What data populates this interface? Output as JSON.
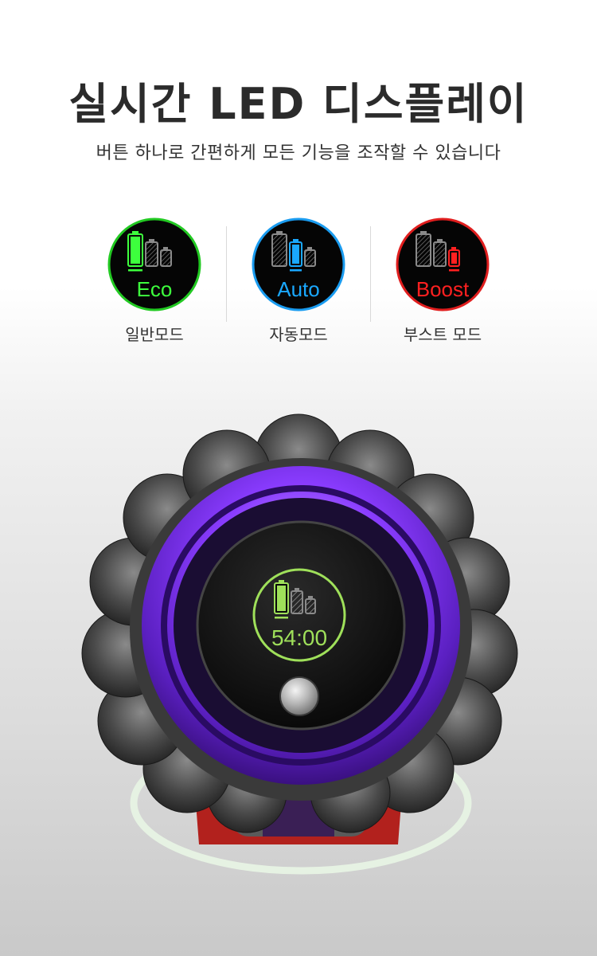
{
  "header": {
    "title": "실시간 LED 디스플레이",
    "subtitle": "버튼 하나로 간편하게 모든 기능을 조작할 수 있습니다"
  },
  "modes": [
    {
      "badge": "Eco",
      "label": "일반모드",
      "accent": "#3dff3d",
      "ring": "#22c922",
      "icon": "battery-high-icon"
    },
    {
      "badge": "Auto",
      "label": "자동모드",
      "accent": "#1aa8ff",
      "ring": "#1a9cf0",
      "icon": "battery-medium-icon"
    },
    {
      "badge": "Boost",
      "label": "부스트 모드",
      "accent": "#ff2020",
      "ring": "#e01e1e",
      "icon": "battery-low-icon"
    }
  ],
  "display": {
    "time": "54:00",
    "accent": "#9fe05a",
    "glow": "#8a3cff"
  }
}
